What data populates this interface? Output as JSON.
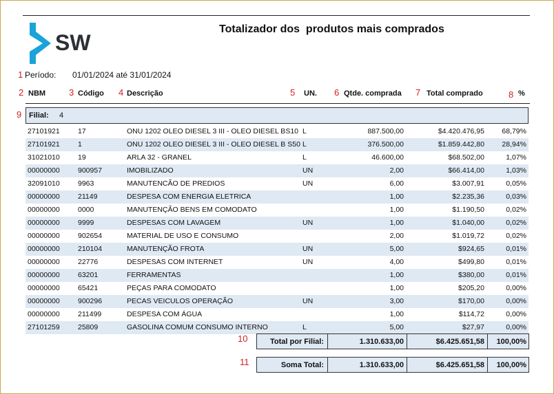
{
  "report": {
    "title": "Totalizador dos  produtos mais comprados",
    "logo_text": "SW",
    "period_label": "Período:",
    "period_value": "01/01/2024 até 31/01/2024"
  },
  "colors": {
    "accent_blue": "#1aa3d8",
    "row_alt": "#dfe9f3",
    "annotation_red": "#d62020"
  },
  "annotations": [
    "1",
    "2",
    "3",
    "4",
    "5",
    "6",
    "7",
    "8",
    "9",
    "10",
    "11"
  ],
  "columns": {
    "nbm": "NBM",
    "codigo": "Código",
    "descricao": "Descrição",
    "un": "UN.",
    "qtde": "Qtde. comprada",
    "total": "Total comprado",
    "pct": "%"
  },
  "filial": {
    "label": "Filial:",
    "value": "4"
  },
  "rows": [
    {
      "nbm": "27101921",
      "codigo": "17",
      "descricao": "ONU 1202 OLEO DIESEL 3 III - OLEO DIESEL BS10",
      "un": "L",
      "qtde": "887.500,00",
      "total": "$4.420.476,95",
      "pct": "68,79%"
    },
    {
      "nbm": "27101921",
      "codigo": "1",
      "descricao": "ONU 1202 OLEO DIESEL 3 III - OLEO DIESEL B S50",
      "un": "L",
      "qtde": "376.500,00",
      "total": "$1.859.442,80",
      "pct": "28,94%"
    },
    {
      "nbm": "31021010",
      "codigo": "19",
      "descricao": "ARLA 32 - GRANEL",
      "un": "L",
      "qtde": "46.600,00",
      "total": "$68.502,00",
      "pct": "1,07%"
    },
    {
      "nbm": "00000000",
      "codigo": "900957",
      "descricao": "IMOBILIZADO",
      "un": "UN",
      "qtde": "2,00",
      "total": "$66.414,00",
      "pct": "1,03%"
    },
    {
      "nbm": "32091010",
      "codigo": "9963",
      "descricao": "MANUTENCÃO DE PREDIOS",
      "un": "UN",
      "qtde": "6,00",
      "total": "$3.007,91",
      "pct": "0,05%"
    },
    {
      "nbm": "00000000",
      "codigo": "21149",
      "descricao": "DESPESA COM ENERGIA ELETRICA",
      "un": "",
      "qtde": "1,00",
      "total": "$2.235,36",
      "pct": "0,03%"
    },
    {
      "nbm": "00000000",
      "codigo": "0000",
      "descricao": "MANUTENÇÃO BENS EM COMODATO",
      "un": "",
      "qtde": "1,00",
      "total": "$1.190,50",
      "pct": "0,02%"
    },
    {
      "nbm": "00000000",
      "codigo": "9999",
      "descricao": "DESPESAS COM LAVAGEM",
      "un": "UN",
      "qtde": "1,00",
      "total": "$1.040,00",
      "pct": "0,02%"
    },
    {
      "nbm": "00000000",
      "codigo": "902654",
      "descricao": "MATERIAL DE USO E CONSUMO",
      "un": "",
      "qtde": "2,00",
      "total": "$1.019,72",
      "pct": "0,02%"
    },
    {
      "nbm": "00000000",
      "codigo": "210104",
      "descricao": "MANUTENÇÃO FROTA",
      "un": "UN",
      "qtde": "5,00",
      "total": "$924,65",
      "pct": "0,01%"
    },
    {
      "nbm": "00000000",
      "codigo": "22776",
      "descricao": "DESPESAS COM INTERNET",
      "un": "UN",
      "qtde": "4,00",
      "total": "$499,80",
      "pct": "0,01%"
    },
    {
      "nbm": "00000000",
      "codigo": "63201",
      "descricao": "FERRAMENTAS",
      "un": "",
      "qtde": "1,00",
      "total": "$380,00",
      "pct": "0,01%"
    },
    {
      "nbm": "00000000",
      "codigo": "65421",
      "descricao": "PEÇAS PARA COMODATO",
      "un": "",
      "qtde": "1,00",
      "total": "$205,20",
      "pct": "0,00%"
    },
    {
      "nbm": "00000000",
      "codigo": "900296",
      "descricao": "PECAS VEICULOS OPERAÇÃO",
      "un": "UN",
      "qtde": "3,00",
      "total": "$170,00",
      "pct": "0,00%"
    },
    {
      "nbm": "00000000",
      "codigo": "211499",
      "descricao": "DESPESA COM ÁGUA",
      "un": "",
      "qtde": "1,00",
      "total": "$114,72",
      "pct": "0,00%"
    },
    {
      "nbm": "27101259",
      "codigo": "25809",
      "descricao": "GASOLINA COMUM CONSUMO INTERNO",
      "un": "L",
      "qtde": "5,00",
      "total": "$27,97",
      "pct": "0,00%"
    }
  ],
  "total_filial": {
    "label": "Total por Filial:",
    "qtde": "1.310.633,00",
    "total": "$6.425.651,58",
    "pct": "100,00%"
  },
  "soma_total": {
    "label": "Soma Total:",
    "qtde": "1.310.633,00",
    "total": "$6.425.651,58",
    "pct": "100,00%"
  }
}
